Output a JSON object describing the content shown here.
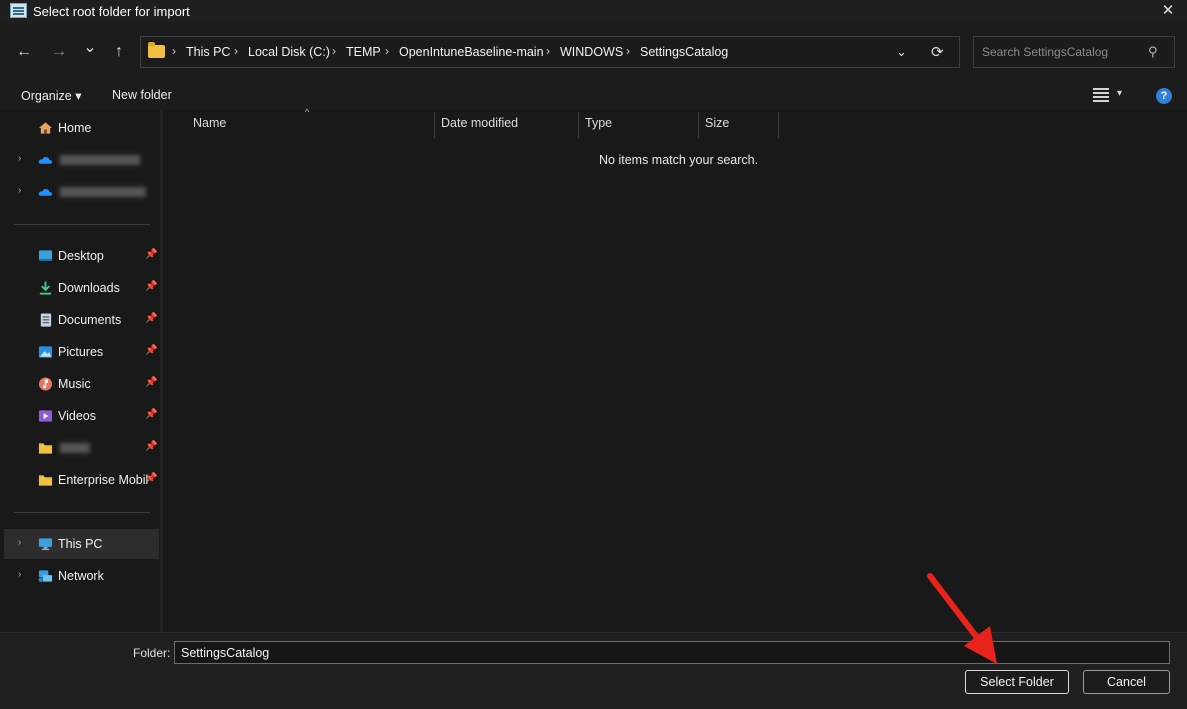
{
  "window": {
    "title": "Select root folder for import",
    "close": "✕"
  },
  "nav": {
    "back": "←",
    "forward": "→",
    "recent": "⌄",
    "up": "↑"
  },
  "address": {
    "crumbs": [
      "This PC",
      "Local Disk (C:)",
      "TEMP",
      "OpenIntuneBaseline-main",
      "WINDOWS",
      "SettingsCatalog"
    ],
    "sep": "›",
    "dropdown": "⌄",
    "refresh": "⟳"
  },
  "search": {
    "placeholder": "Search SettingsCatalog",
    "icon": "⚲"
  },
  "toolbar": {
    "organize": "Organize ▾",
    "new_folder": "New folder",
    "view_chevron": "▾",
    "help": "?"
  },
  "sidebar": {
    "home": "Home",
    "quick_access": [
      {
        "label": "Desktop",
        "icon": "desktop-icon"
      },
      {
        "label": "Downloads",
        "icon": "downloads-icon"
      },
      {
        "label": "Documents",
        "icon": "documents-icon"
      },
      {
        "label": "Pictures",
        "icon": "pictures-icon"
      },
      {
        "label": "Music",
        "icon": "music-icon"
      },
      {
        "label": "Videos",
        "icon": "videos-icon"
      },
      {
        "label": "",
        "icon": "folder-icon"
      },
      {
        "label": "Enterprise Mobil",
        "icon": "folder-icon"
      }
    ],
    "this_pc": "This PC",
    "network": "Network",
    "expander": "›",
    "pin": "📌"
  },
  "file_list": {
    "columns": [
      "Name",
      "Date modified",
      "Type",
      "Size"
    ],
    "sort_caret": "^",
    "empty_message": "No items match your search."
  },
  "footer": {
    "folder_label": "Folder:",
    "folder_value": "SettingsCatalog",
    "select_button": "Select Folder",
    "cancel_button": "Cancel"
  },
  "colors": {
    "accent": "#2f7fdc",
    "arrow": "#e8231b",
    "background": "#191919"
  }
}
